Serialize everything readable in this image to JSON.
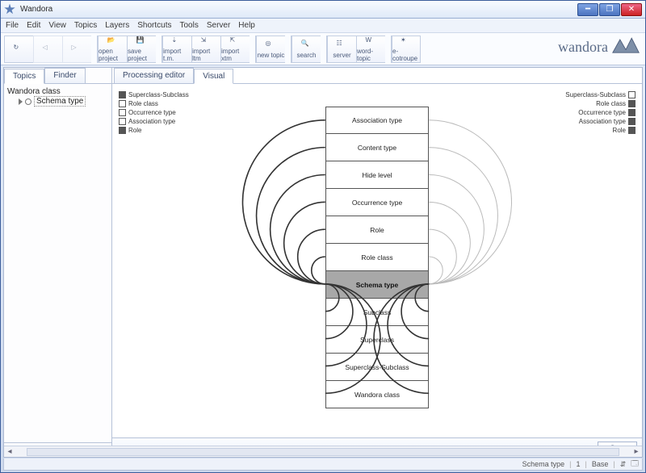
{
  "window": {
    "title": "Wandora"
  },
  "menu": [
    "File",
    "Edit",
    "View",
    "Topics",
    "Layers",
    "Shortcuts",
    "Tools",
    "Server",
    "Help"
  ],
  "toolbar": [
    {
      "name": "refresh",
      "label": "",
      "icon": "refresh"
    },
    {
      "name": "back",
      "label": "",
      "icon": "tri-left",
      "disabled": true
    },
    {
      "name": "fwd",
      "label": "",
      "icon": "tri-right",
      "disabled": true
    },
    {
      "sep": true
    },
    {
      "name": "open-project",
      "label": "open project",
      "icon": "open"
    },
    {
      "name": "save-project",
      "label": "save project",
      "icon": "save"
    },
    {
      "sep": true
    },
    {
      "name": "import-tm",
      "label": "import t.m.",
      "icon": "import"
    },
    {
      "name": "import-ltm",
      "label": "import ltm",
      "icon": "import2"
    },
    {
      "name": "import-xtm",
      "label": "import xtm",
      "icon": "import3"
    },
    {
      "sep": true
    },
    {
      "name": "new-topic",
      "label": "new topic",
      "icon": "cube"
    },
    {
      "sep": true
    },
    {
      "name": "search",
      "label": "search",
      "icon": "search"
    },
    {
      "sep": true
    },
    {
      "name": "server",
      "label": "server",
      "icon": "server"
    },
    {
      "name": "word-topic",
      "label": "word-topic",
      "icon": "word"
    },
    {
      "sep": true
    },
    {
      "name": "ecotroupe",
      "label": "e-cotroupe",
      "icon": "shape"
    }
  ],
  "brand": "wandora",
  "sidebar": {
    "tabs": [
      "Topics",
      "Finder"
    ],
    "active_tab": 0,
    "root": "Wandora class",
    "child": "Schema type",
    "status": "Base"
  },
  "right": {
    "tabs": [
      "Processing editor",
      "Visual"
    ],
    "active_tab": 1,
    "stop": "Stop"
  },
  "legend_left": [
    {
      "label": "Superclass-Subclass",
      "filled": true
    },
    {
      "label": "Role class",
      "filled": false
    },
    {
      "label": "Occurrence type",
      "filled": false
    },
    {
      "label": "Association type",
      "filled": false
    },
    {
      "label": "Role",
      "filled": true
    }
  ],
  "legend_right": [
    {
      "label": "Superclass-Subclass",
      "filled": false
    },
    {
      "label": "Role class",
      "filled": true
    },
    {
      "label": "Occurrence type",
      "filled": true
    },
    {
      "label": "Association type",
      "filled": true
    },
    {
      "label": "Role",
      "filled": true
    }
  ],
  "nodes": [
    "Association type",
    "Content type",
    "Hide level",
    "Occurrence type",
    "Role",
    "Role class",
    "Schema type",
    "Subclass",
    "Superclass",
    "Superclass-Subclass",
    "Wandora class"
  ],
  "selected_index": 6,
  "status": {
    "context": "Schema type",
    "count": "1",
    "layer": "Base"
  }
}
